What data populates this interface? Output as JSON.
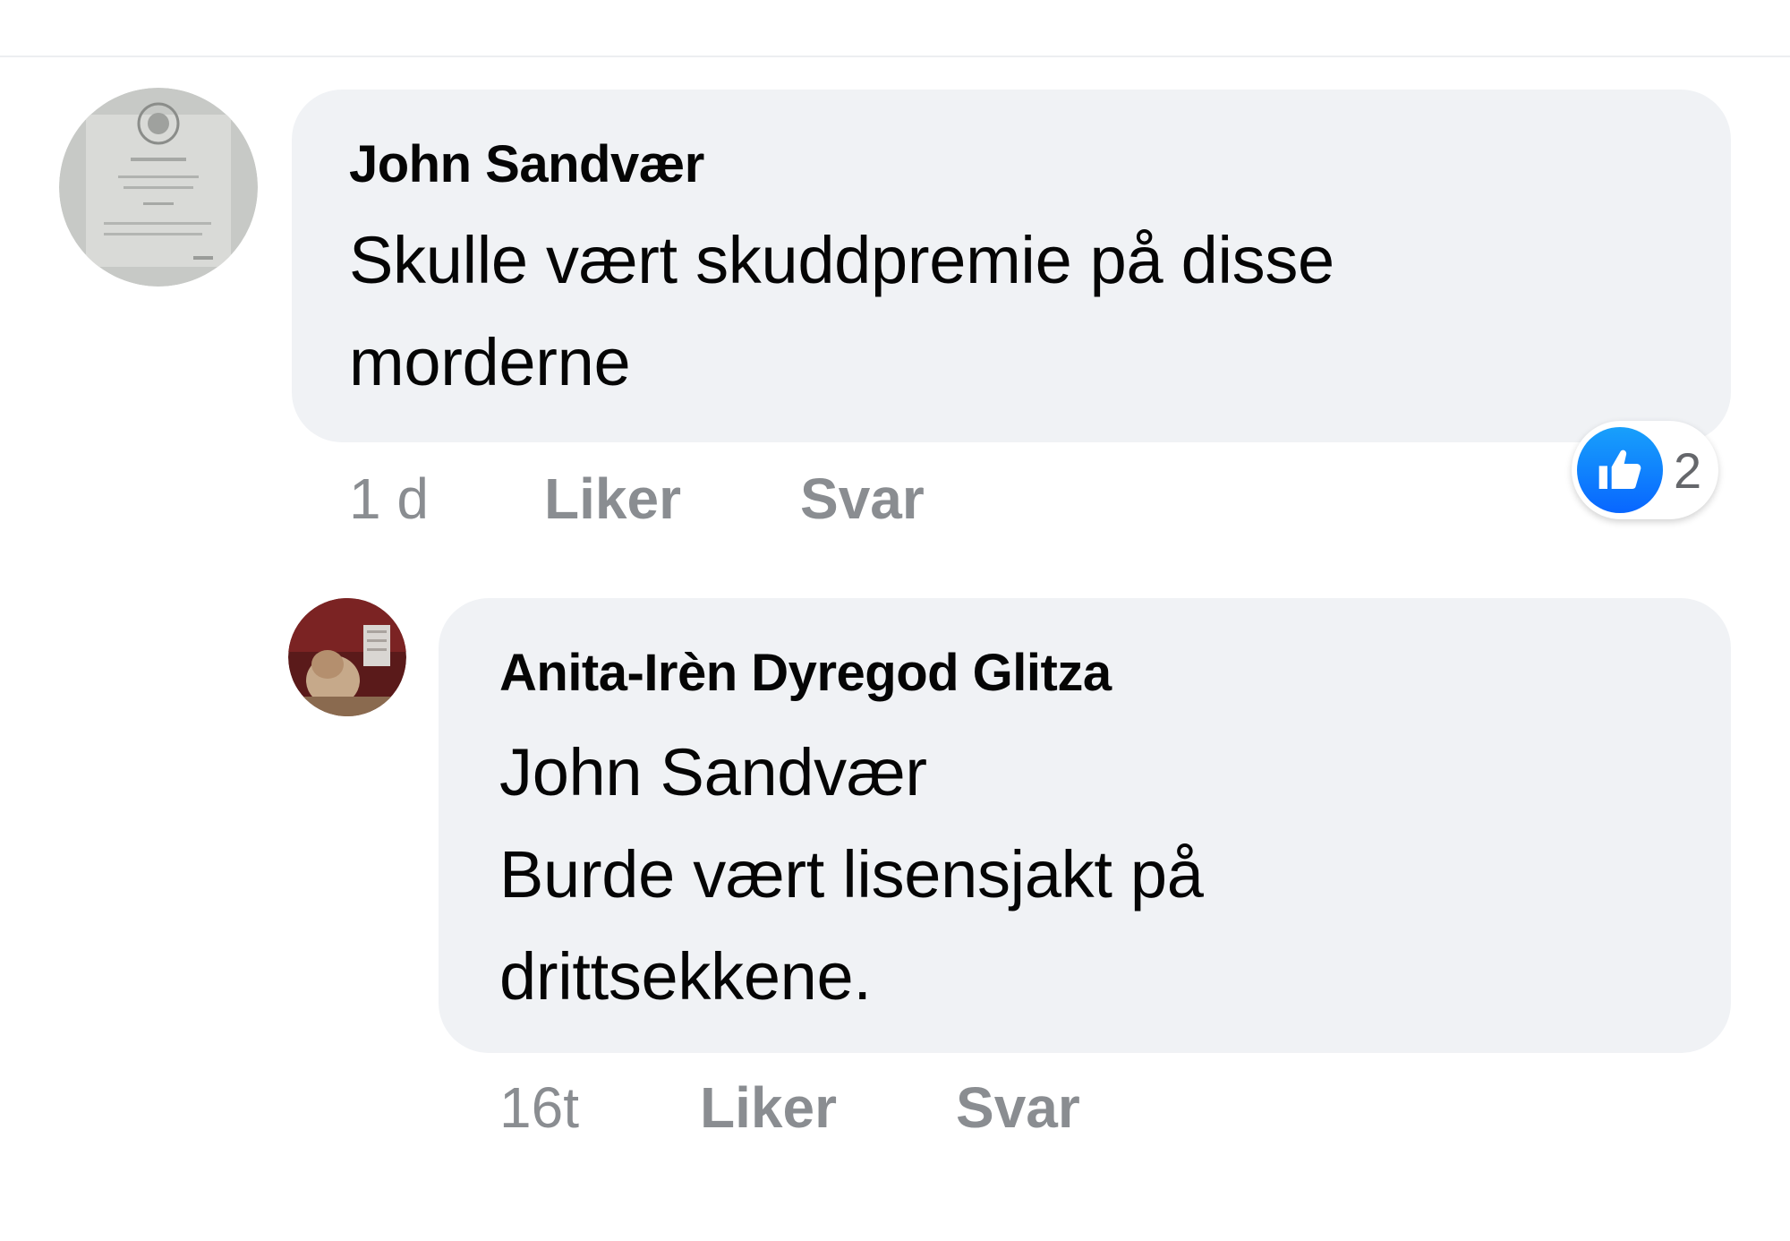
{
  "comments": [
    {
      "author": "John Sandvær",
      "lines": [
        "Skulle vært skuddpremie på disse",
        "morderne"
      ],
      "time": "1 d",
      "like_label": "Liker",
      "reply_label": "Svar",
      "reaction": {
        "icon": "thumbs-up-icon",
        "count": "2",
        "color": "#0866ff"
      }
    },
    {
      "author": "Anita-Irèn Dyregod Glitza",
      "lines": [
        "John Sandvær",
        "Burde vært lisensjakt på",
        "drittsekkene."
      ],
      "time": "16t",
      "like_label": "Liker",
      "reply_label": "Svar"
    }
  ],
  "colors": {
    "bubble": "#f0f2f5",
    "meta_text": "#8a8d91",
    "body_text": "#050505"
  }
}
